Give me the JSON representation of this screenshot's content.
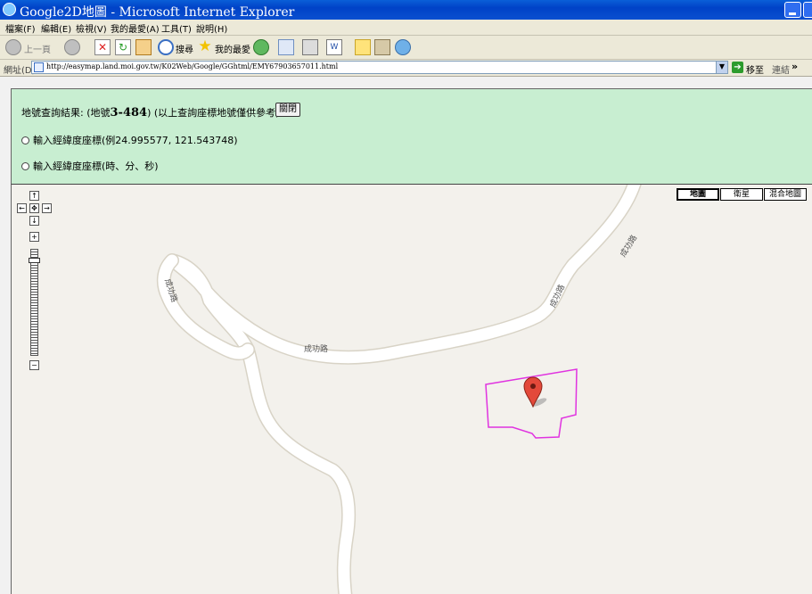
{
  "window": {
    "title": "Google2D地圖 - Microsoft Internet Explorer"
  },
  "menu": [
    "檔案(F)",
    "編輯(E)",
    "檢視(V)",
    "我的最愛(A)",
    "工具(T)",
    "說明(H)"
  ],
  "toolbar": {
    "back_label": "上一頁",
    "search_label": "搜尋",
    "favorites_label": "我的最愛"
  },
  "address": {
    "label": "網址(D)",
    "url": "http://easymap.land.moi.gov.tw/K02Web/Google/GGhtml/EMY67903657011.html",
    "go_label": "移至",
    "links_label": "連結",
    "chevron": "»"
  },
  "result": {
    "prefix": "地號查詢結果: (地號",
    "parcel": "3-484",
    "suffix": ") (以上查詢座標地號僅供參考)",
    "close_label": "關閉"
  },
  "options": {
    "decimal_label": "輸入經緯度座標(例24.995577, 121.543748)",
    "dms_label": "輸入經緯度座標(時、分、秒)"
  },
  "map": {
    "types": [
      "地圖",
      "衛星",
      "混合地圖"
    ],
    "selected_type": "地圖",
    "controls": {
      "up": "↑",
      "left": "←",
      "center": "✥",
      "right": "→",
      "down": "↓",
      "zoom_in": "+",
      "zoom_out": "−"
    },
    "roads": {
      "label_a": "成功路",
      "label_b": "成功路",
      "label_c": "成功路",
      "label_d": "成功路"
    },
    "colors": {
      "parcel_outline": "#e033e0",
      "marker": "#e3493a",
      "road": "#ffffff",
      "road_edge": "#d8d3c6"
    }
  }
}
